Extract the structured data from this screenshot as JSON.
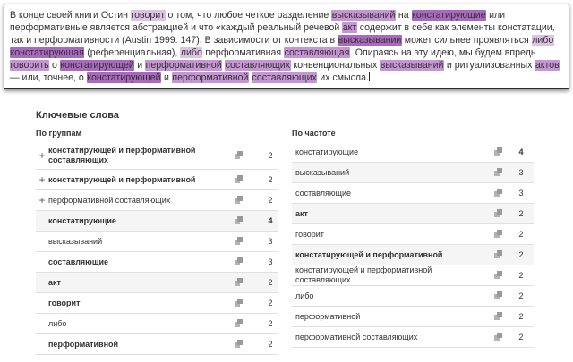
{
  "text": {
    "segments": [
      {
        "t": "В конце своей книги Остин ",
        "h": ""
      },
      {
        "t": "говорит",
        "h": "a"
      },
      {
        "t": " о том, что любое четкое разделение ",
        "h": ""
      },
      {
        "t": "высказываний",
        "h": "b"
      },
      {
        "t": " на ",
        "h": ""
      },
      {
        "t": "констатирующие",
        "h": "c"
      },
      {
        "t": " или перформативные является абстракцией и что «каждый реальный речевой ",
        "h": ""
      },
      {
        "t": "акт",
        "h": "b"
      },
      {
        "t": " содержит в себе как элементы констатации, так и перформативности (Austin 1999: 147). В зависимости от контекста в ",
        "h": ""
      },
      {
        "t": "высказывании",
        "h": "c"
      },
      {
        "t": " может сильнее проявляться ",
        "h": ""
      },
      {
        "t": "либо",
        "h": "a"
      },
      {
        "t": " ",
        "h": ""
      },
      {
        "t": "констатирующая",
        "h": "c"
      },
      {
        "t": " (референциальная), ",
        "h": ""
      },
      {
        "t": "либо",
        "h": "a"
      },
      {
        "t": " перформативная ",
        "h": ""
      },
      {
        "t": "составляющая",
        "h": "b"
      },
      {
        "t": ". Опираясь на эту идею, мы будем впредь ",
        "h": ""
      },
      {
        "t": "говорить",
        "h": "b"
      },
      {
        "t": " о ",
        "h": ""
      },
      {
        "t": "констатирующей",
        "h": "c"
      },
      {
        "t": " и ",
        "h": ""
      },
      {
        "t": "перформативной",
        "h": "b"
      },
      {
        "t": " ",
        "h": ""
      },
      {
        "t": "составляющих",
        "h": "b"
      },
      {
        "t": " конвенциональных ",
        "h": ""
      },
      {
        "t": "высказываний",
        "h": "b"
      },
      {
        "t": " и ритуализованных ",
        "h": ""
      },
      {
        "t": "актов",
        "h": "b"
      },
      {
        "t": " — или, точнее, о ",
        "h": ""
      },
      {
        "t": "констатирующей",
        "h": "c"
      },
      {
        "t": " и ",
        "h": ""
      },
      {
        "t": "перформативной",
        "h": "b"
      },
      {
        "t": " ",
        "h": ""
      },
      {
        "t": "составляющих",
        "h": "b"
      },
      {
        "t": " их смысла.",
        "h": ""
      }
    ]
  },
  "keywords": {
    "title": "Ключевые слова",
    "by_group": {
      "header": "По группам",
      "rows": [
        {
          "label": "констатирующей и перформативной составляющих",
          "count": "2",
          "expandable": true,
          "bold": true,
          "bold_count": false,
          "shade": false,
          "height": 31
        },
        {
          "label": "констатирующей и перформативной",
          "count": "2",
          "expandable": true,
          "bold": true,
          "bold_count": false,
          "shade": false,
          "height": 23
        },
        {
          "label": "перформативной составляющих",
          "count": "2",
          "expandable": true,
          "bold": false,
          "bold_count": false,
          "shade": false,
          "height": 23
        },
        {
          "label": "констатирующие",
          "count": "4",
          "expandable": false,
          "bold": true,
          "bold_count": true,
          "shade": true,
          "height": 23
        },
        {
          "label": "высказываний",
          "count": "3",
          "expandable": false,
          "bold": false,
          "bold_count": false,
          "shade": false,
          "height": 23
        },
        {
          "label": "составляющие",
          "count": "3",
          "expandable": false,
          "bold": true,
          "bold_count": false,
          "shade": false,
          "height": 23
        },
        {
          "label": "акт",
          "count": "2",
          "expandable": false,
          "bold": true,
          "bold_count": false,
          "shade": true,
          "height": 23
        },
        {
          "label": "говорит",
          "count": "2",
          "expandable": false,
          "bold": true,
          "bold_count": false,
          "shade": false,
          "height": 23
        },
        {
          "label": "либо",
          "count": "2",
          "expandable": false,
          "bold": false,
          "bold_count": false,
          "shade": false,
          "height": 23
        },
        {
          "label": "перформативной",
          "count": "2",
          "expandable": false,
          "bold": true,
          "bold_count": false,
          "shade": false,
          "height": 23
        }
      ]
    },
    "by_frequency": {
      "header": "По частоте",
      "rows": [
        {
          "label": "констатирующие",
          "count": "4",
          "bold": false,
          "bold_count": true,
          "shade": false,
          "height": 23
        },
        {
          "label": "высказываний",
          "count": "3",
          "bold": false,
          "bold_count": false,
          "shade": true,
          "height": 23
        },
        {
          "label": "составляющие",
          "count": "3",
          "bold": false,
          "bold_count": false,
          "shade": false,
          "height": 23
        },
        {
          "label": "акт",
          "count": "2",
          "bold": true,
          "bold_count": false,
          "shade": true,
          "height": 23
        },
        {
          "label": "говорит",
          "count": "2",
          "bold": false,
          "bold_count": false,
          "shade": false,
          "height": 23
        },
        {
          "label": "констатирующей и перформативной",
          "count": "2",
          "bold": true,
          "bold_count": false,
          "shade": true,
          "height": 23
        },
        {
          "label": "констатирующей и перформативной составляющих",
          "count": "2",
          "bold": false,
          "bold_count": false,
          "shade": false,
          "height": 23
        },
        {
          "label": "либо",
          "count": "2",
          "bold": false,
          "bold_count": false,
          "shade": false,
          "height": 23
        },
        {
          "label": "перформативной",
          "count": "2",
          "bold": false,
          "bold_count": false,
          "shade": false,
          "height": 23
        },
        {
          "label": "перформативной составляющих",
          "count": "2",
          "bold": false,
          "bold_count": false,
          "shade": false,
          "height": 23
        }
      ]
    }
  },
  "colors": {
    "highlight_light": "#dcc3e4",
    "highlight_mid": "#c695d4",
    "highlight_dark": "#a969bf"
  },
  "icons": {
    "copy": "copy-icon",
    "expand": "plus-icon"
  }
}
